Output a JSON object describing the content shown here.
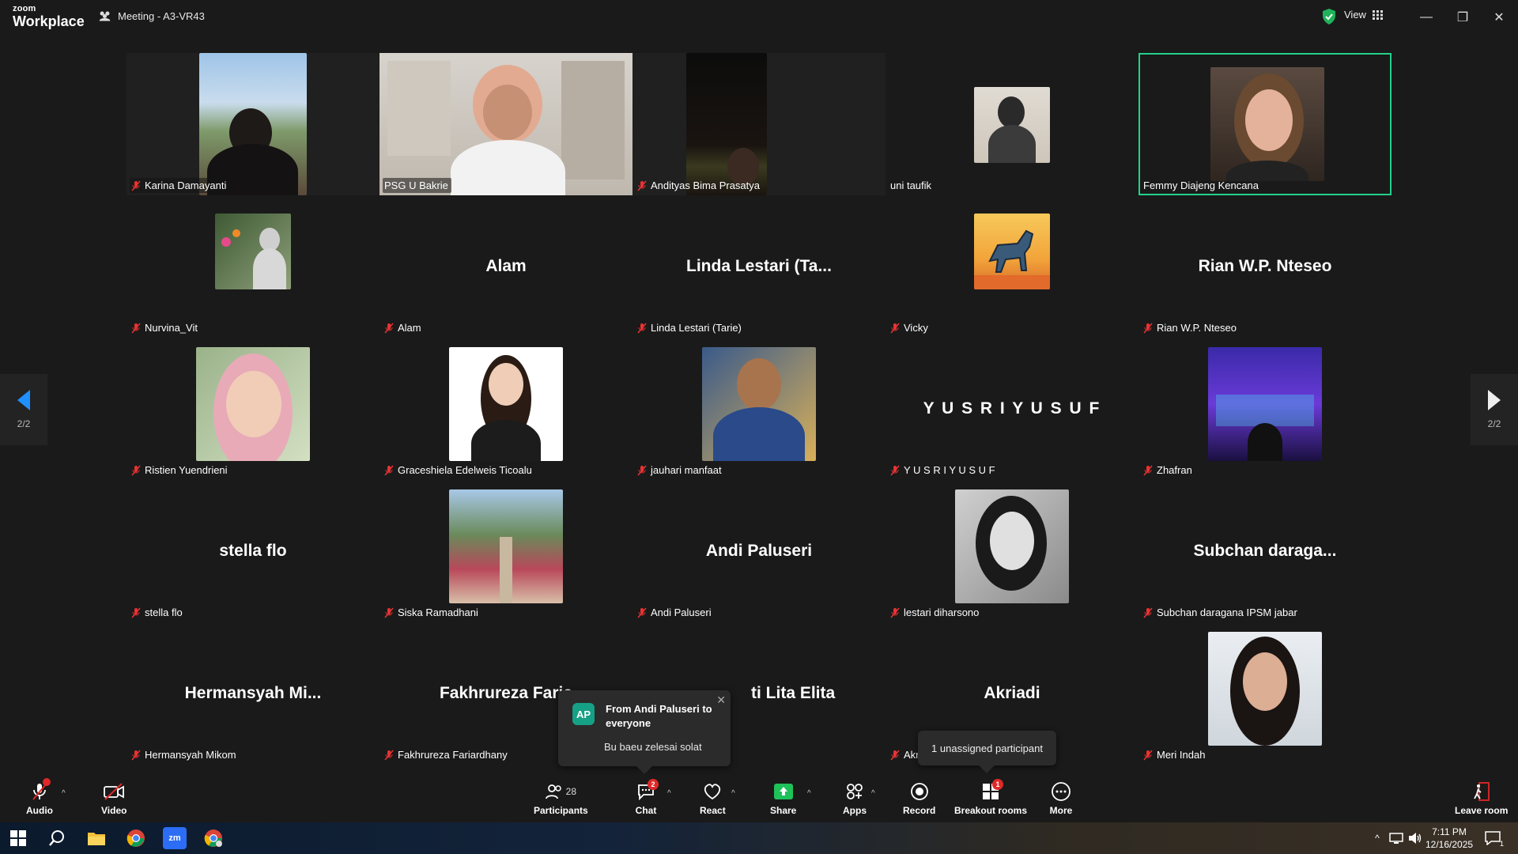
{
  "titlebar": {
    "logo_top": "zoom",
    "logo_bottom": "Workplace",
    "meeting_title": "Meeting - A3-VR43",
    "view_label": "View"
  },
  "tiles": [
    {
      "name": "Karina Damayanti"
    },
    {
      "name": "PSG U Bakrie"
    },
    {
      "name": "Andityas Bima Prasatya"
    },
    {
      "name": "uni taufik"
    },
    {
      "name": "Femmy Diajeng Kencana"
    },
    {
      "name": "Nurvina_Vit"
    },
    {
      "name": "Alam",
      "display": "Alam"
    },
    {
      "name": "Linda Lestari (Tarie)",
      "display": "Linda Lestari (Ta..."
    },
    {
      "name": "Vicky"
    },
    {
      "name": "Rian W.P. Nteseo",
      "display": "Rian W.P. Nteseo"
    },
    {
      "name": "Ristien Yuendrieni"
    },
    {
      "name": "Graceshiela Edelweis Ticoalu"
    },
    {
      "name": "jauhari manfaat"
    },
    {
      "name": "Y U S R I  Y U S U F",
      "display": "Y U S R I  Y U S U F"
    },
    {
      "name": "Zhafran"
    },
    {
      "name": "stella flo",
      "display": "stella flo"
    },
    {
      "name": "Siska Ramadhani"
    },
    {
      "name": "Andi Paluseri",
      "display": "Andi Paluseri"
    },
    {
      "name": "lestari diharsono"
    },
    {
      "name": "Subchan daragana IPSM jabar",
      "display": "Subchan daraga..."
    },
    {
      "name": "Hermansyah Mikom",
      "display": "Hermansyah  Mi..."
    },
    {
      "name": "Fakhrureza Fariardhany",
      "display": "Fakhrureza  Faria"
    },
    {
      "name": "",
      "display": "ti Lita Elita"
    },
    {
      "name": "Akr",
      "display": "Akriadi"
    },
    {
      "name": "Meri Indah"
    }
  ],
  "pager": {
    "left_count": "2/2",
    "right_count": "2/2"
  },
  "chat_popup": {
    "initials": "AP",
    "from": "From Andi Paluseri to everyone",
    "message": "Bu baeu zelesai solat"
  },
  "unassigned": "1 unassigned participant",
  "toolbar": {
    "audio": "Audio",
    "video": "Video",
    "participants": "Participants",
    "participants_count": "28",
    "chat": "Chat",
    "chat_badge": "2",
    "react": "React",
    "share": "Share",
    "apps": "Apps",
    "record": "Record",
    "breakout": "Breakout rooms",
    "breakout_badge": "1",
    "more": "More",
    "leave": "Leave room"
  },
  "taskbar": {
    "time": "7:11 PM",
    "date": "12/16/2025",
    "notif_count": "1"
  },
  "colors": {
    "accent_green": "#23d18b",
    "badge_red": "#e02828",
    "share_green": "#1fc15a"
  }
}
